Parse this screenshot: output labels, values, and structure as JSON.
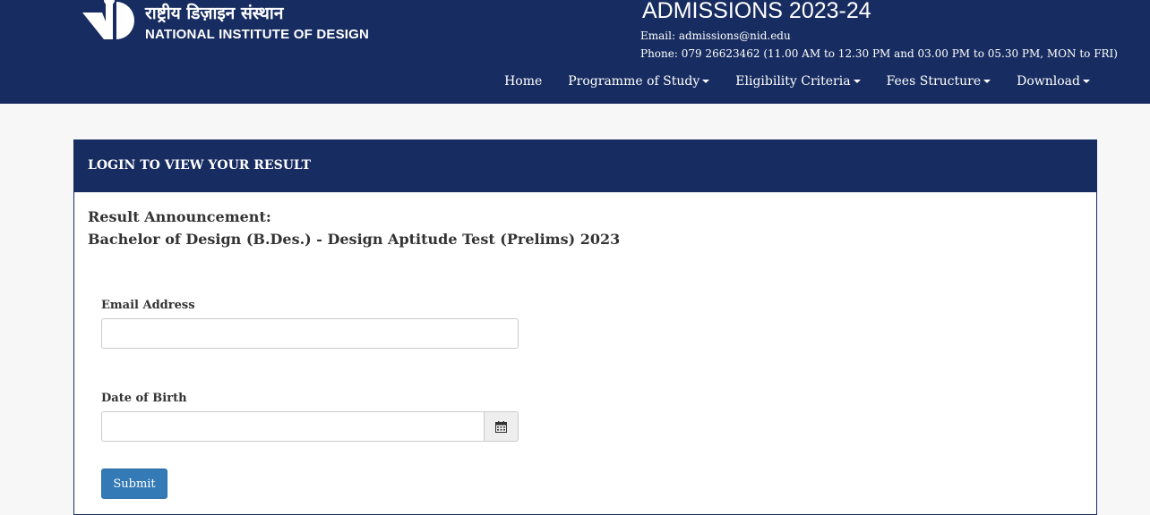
{
  "header": {
    "logo_hindi": "राष्ट्रीय डिज़ाइन संस्थान",
    "logo_english": "NATIONAL INSTITUTE OF DESIGN",
    "admissions_title": "ADMISSIONS 2023-24",
    "email_line": "Email: admissions@nid.edu",
    "phone_line": "Phone: 079 26623462 (11.00 AM to 12.30 PM and 03.00 PM to 05.30 PM, MON to FRI)",
    "background_color": "#172c60"
  },
  "nav": {
    "items": [
      {
        "label": "Home",
        "dropdown": false
      },
      {
        "label": "Programme of Study",
        "dropdown": true
      },
      {
        "label": "Eligibility Criteria",
        "dropdown": true
      },
      {
        "label": "Fees Structure",
        "dropdown": true
      },
      {
        "label": "Download",
        "dropdown": true
      }
    ]
  },
  "panel": {
    "heading": "LOGIN TO VIEW YOUR RESULT",
    "announcement_line1": "Result Announcement:",
    "announcement_line2": "Bachelor of Design (B.Des.) - Design Aptitude Test (Prelims) 2023"
  },
  "form": {
    "email_label": "Email Address",
    "email_value": "",
    "dob_label": "Date of Birth",
    "dob_value": "",
    "calendar_icon": "calendar-icon",
    "submit_label": "Submit",
    "submit_color": "#337ab7"
  }
}
